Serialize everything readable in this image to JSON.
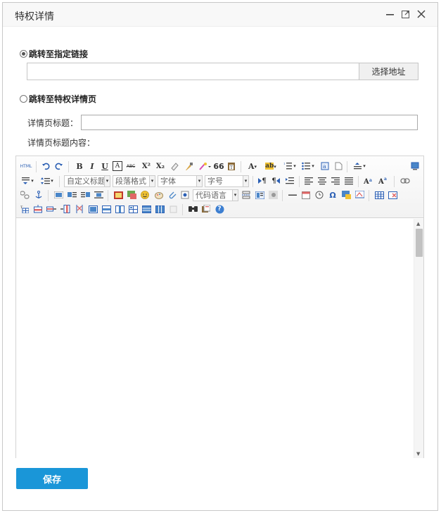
{
  "dialog": {
    "title": "特权详情"
  },
  "options": {
    "link_label": "跳转至指定链接",
    "detail_label": "跳转至特权详情页",
    "selected": "link"
  },
  "link": {
    "url_value": "",
    "select_label": "选择地址"
  },
  "detail": {
    "title_label": "详情页标题：",
    "title_value": "",
    "content_label": "详情页标题内容："
  },
  "editor": {
    "html_label": "HTML",
    "bold": "B",
    "italic": "I",
    "underline": "U",
    "fontborder": "A",
    "strike": "ABC",
    "superscript": "X²",
    "subscript": "X₂",
    "blockquote": "66",
    "forecolor": "A",
    "backcolor": "ab",
    "combos": {
      "heading": "自定义标题",
      "paragraph": "段落格式",
      "font": "字体",
      "size": "字号",
      "code": "代码语言"
    },
    "rtl": "¶",
    "ltr": "¶",
    "omega": "Ω",
    "help": "?"
  },
  "actions": {
    "save_label": "保存"
  },
  "colors": {
    "accent": "#1a96d8"
  }
}
